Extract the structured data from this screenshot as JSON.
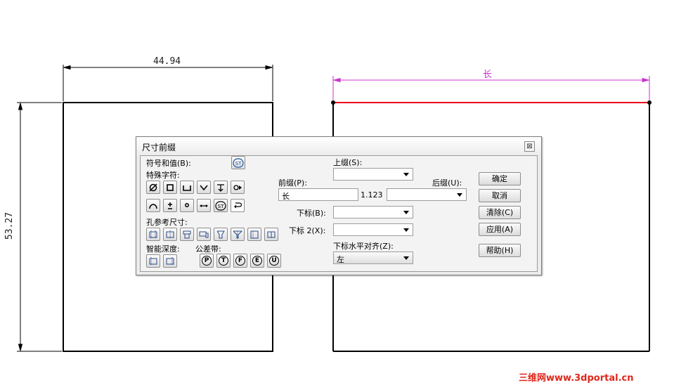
{
  "drawing": {
    "left_width_dim": "44.94",
    "left_height_dim": "53.27",
    "right_width_dim": "长",
    "watermark": "三维网www.3dportal.cn",
    "colors": {
      "magenta": "#cc33cc",
      "red": "#e8001c",
      "black": "#000000"
    }
  },
  "dialog": {
    "title": "尺寸前缀",
    "close_glyph": "⊠",
    "labels": {
      "symbol_value": "符号和值(B):",
      "special_chars": "特殊字符:",
      "hole_ref": "孔参考尺寸:",
      "smart_depth": "智能深度:",
      "tolerance_band": "公差带:",
      "superscript": "上缀(S):",
      "prefix": "前缀(P):",
      "suffix": "后缀(U):",
      "subscript": "下标(B):",
      "subscript2": "下标 2(X):",
      "sub_align": "下标水平对齐(Z):",
      "value": "1.123"
    },
    "st_icon_text": "ST",
    "prefix_value": "长",
    "align_value": "左",
    "buttons": {
      "ok": "确定",
      "cancel": "取消",
      "clear": "清除(C)",
      "apply": "应用(A)",
      "help": "帮助(H)"
    },
    "tolerance_letters": [
      "P",
      "T",
      "F",
      "E",
      "U"
    ]
  }
}
